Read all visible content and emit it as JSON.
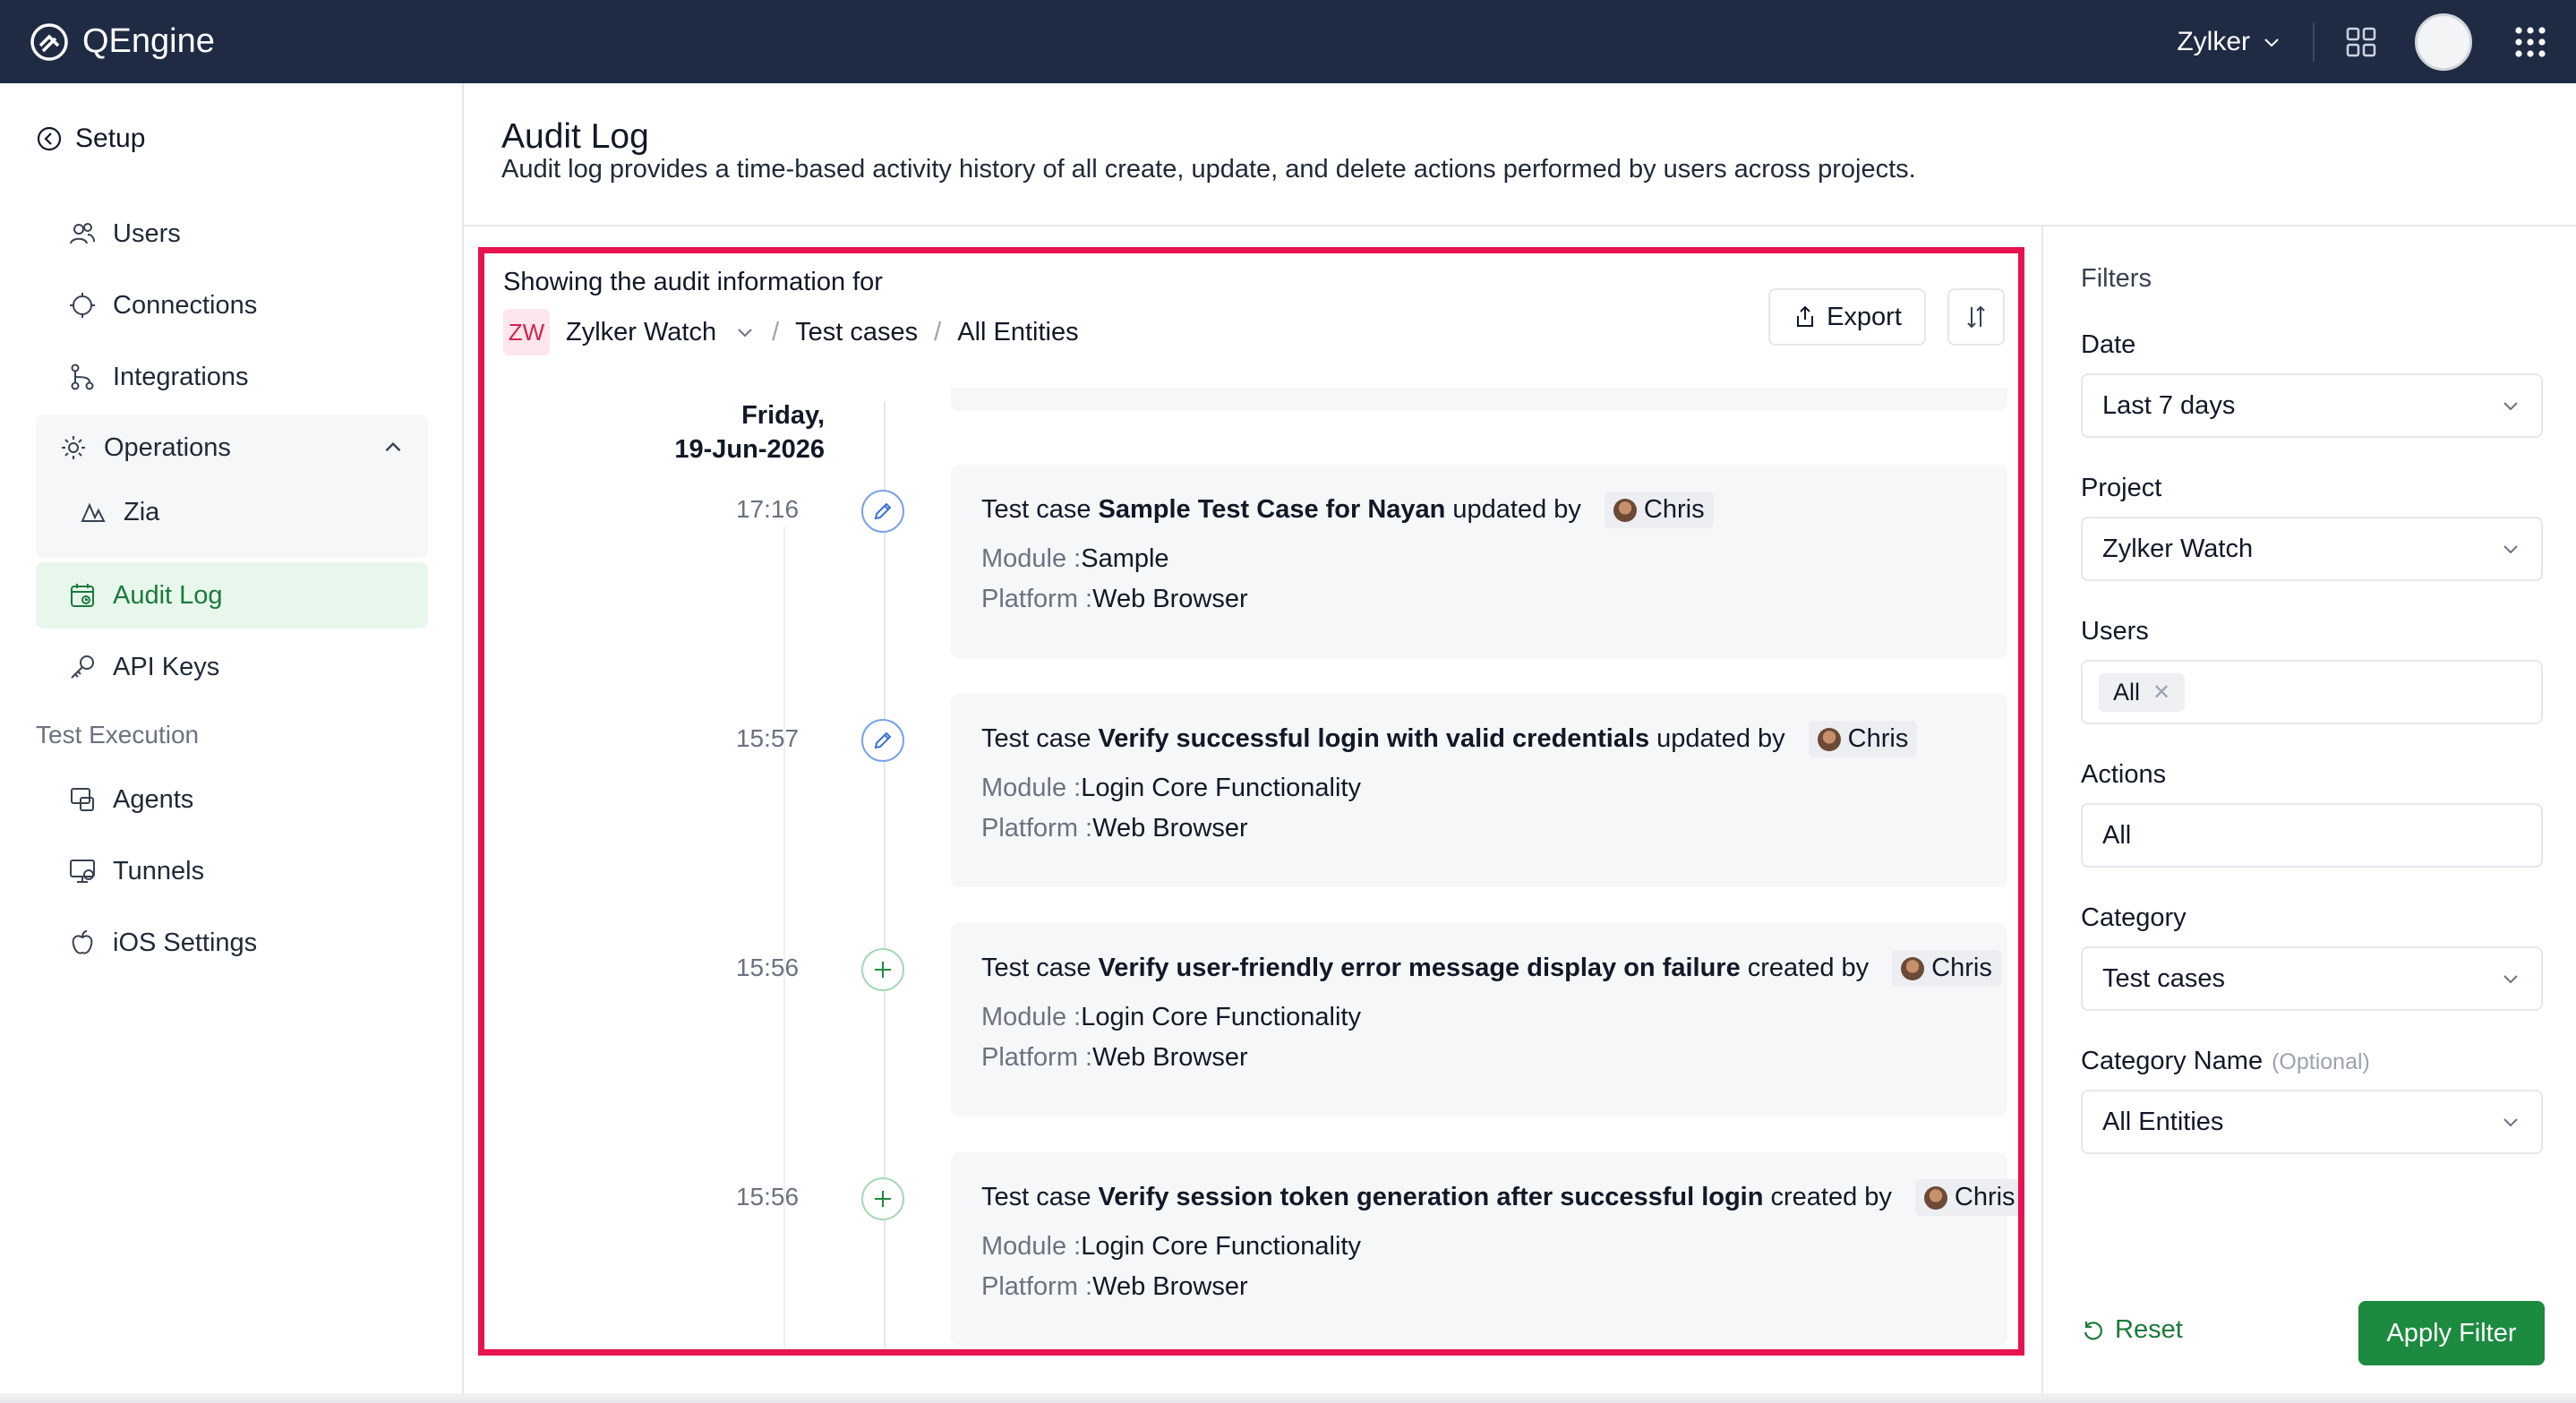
{
  "app": {
    "name": "QEngine"
  },
  "topbar": {
    "org": "Zylker"
  },
  "sidebar": {
    "setup": "Setup",
    "items": [
      {
        "label": "Users"
      },
      {
        "label": "Connections"
      },
      {
        "label": "Integrations"
      },
      {
        "label": "Operations"
      },
      {
        "label": "Zia"
      },
      {
        "label": "Audit Log"
      },
      {
        "label": "API Keys"
      }
    ],
    "section": "Test Execution",
    "exec_items": [
      {
        "label": "Agents"
      },
      {
        "label": "Tunnels"
      },
      {
        "label": "iOS Settings"
      }
    ]
  },
  "header": {
    "title": "Audit Log",
    "description": "Audit log provides a time-based activity history of all create, update, and delete actions performed by users across projects."
  },
  "log": {
    "showing": "Showing the audit information for",
    "project_badge": "ZW",
    "project": "Zylker Watch",
    "sep": "/",
    "category": "Test cases",
    "entities": "All Entities",
    "export_label": "Export",
    "date_line1": "Friday,",
    "date_line2": "19-Jun-2026",
    "module_label": "Module :",
    "platform_label": "Platform :",
    "entries": [
      {
        "time": "17:16",
        "prefix": "Test case",
        "name": "Sample Test Case for Nayan",
        "action": "updated by",
        "user": "Chris",
        "module": "Sample",
        "platform": "Web Browser"
      },
      {
        "time": "15:57",
        "prefix": "Test case",
        "name": "Verify successful login with valid credentials",
        "action": "updated by",
        "user": "Chris",
        "module": "Login Core Functionality",
        "platform": "Web Browser"
      },
      {
        "time": "15:56",
        "prefix": "Test case",
        "name": "Verify user-friendly error message display on failure",
        "action": "created by",
        "user": "Chris",
        "module": "Login Core Functionality",
        "platform": "Web Browser"
      },
      {
        "time": "15:56",
        "prefix": "Test case",
        "name": "Verify session token generation after successful login",
        "action": "created by",
        "user": "Chris",
        "module": "Login Core Functionality",
        "platform": "Web Browser"
      }
    ]
  },
  "filters": {
    "title": "Filters",
    "date_label": "Date",
    "date_value": "Last 7 days",
    "project_label": "Project",
    "project_value": "Zylker Watch",
    "users_label": "Users",
    "users_chip": "All",
    "actions_label": "Actions",
    "actions_value": "All",
    "category_label": "Category",
    "category_value": "Test cases",
    "category_name_label": "Category Name",
    "category_name_optional": "(Optional)",
    "category_name_value": "All Entities",
    "reset": "Reset",
    "apply": "Apply Filter"
  },
  "colors": {
    "topbar": "#1e2b43",
    "accent_green": "#1c8a3f",
    "highlight": "#e8124f"
  }
}
